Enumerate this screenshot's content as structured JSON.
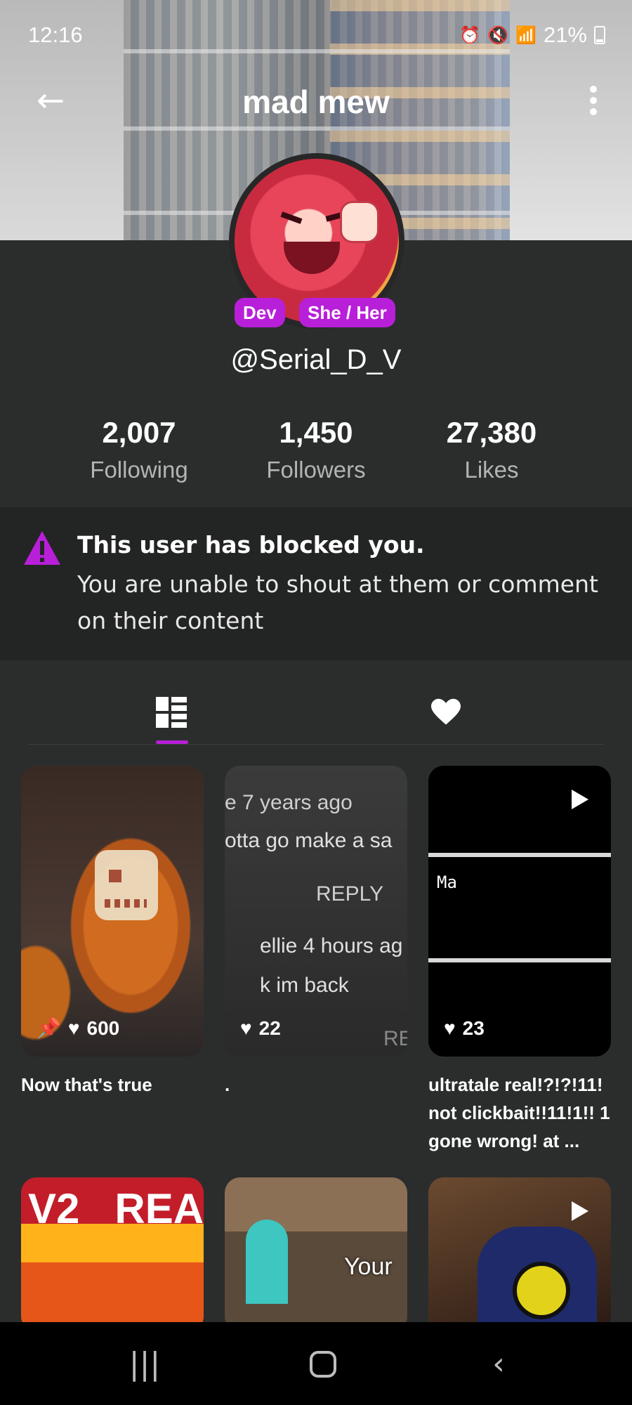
{
  "status_bar": {
    "time": "12:16",
    "battery": "21%"
  },
  "header": {
    "title": "mad mew"
  },
  "profile": {
    "badges": [
      "Dev",
      "She / Her"
    ],
    "username": "@Serial_D_V",
    "stats": [
      {
        "value": "2,007",
        "label": "Following"
      },
      {
        "value": "1,450",
        "label": "Followers"
      },
      {
        "value": "27,380",
        "label": "Likes"
      }
    ]
  },
  "blocked_notice": {
    "title": "This user has blocked you.",
    "message": "You are unable to shout at them or comment on their content"
  },
  "tabs": [
    {
      "name": "posts",
      "icon": "grid-icon",
      "selected": true
    },
    {
      "name": "likes",
      "icon": "heart-icon",
      "selected": false
    }
  ],
  "posts": [
    {
      "likes": "600",
      "pinned": true,
      "caption": "Now that's true"
    },
    {
      "likes": "22",
      "pinned": false,
      "caption": ".",
      "thumb_text": [
        "e 7 years ago",
        "otta go make a sa",
        "REPLY",
        "ellie 4 hours ag",
        "k im back",
        "RE"
      ]
    },
    {
      "likes": "23",
      "pinned": false,
      "caption": "ultratale real!?!?!11! not clickbait!!11!1!! 1 gone wrong! at ...",
      "thumb_text": [
        "Ma"
      ],
      "video": true
    },
    {
      "thumb_text": [
        "V2",
        "REA"
      ]
    },
    {
      "thumb_text": [
        "Your"
      ]
    },
    {
      "video": true
    }
  ],
  "colors": {
    "accent": "#b81fd9",
    "background": "#2b2d2d",
    "notice_bg": "#232424"
  }
}
